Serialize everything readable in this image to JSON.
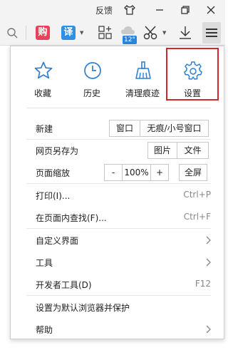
{
  "titlebar": {
    "feedback_label": "反馈",
    "skin_icon": "tshirt-icon",
    "minimize_icon": "minimize-icon",
    "restore_icon": "restore-icon",
    "close_icon": "close-icon"
  },
  "toolbar": {
    "search_icon": "search-icon",
    "shop_badge": "购",
    "translate_badge": "译",
    "apps_icon": "apps-grid-icon",
    "weather_temp": "12°",
    "screenshot_icon": "scissors-icon",
    "download_icon": "download-icon",
    "menu_icon": "hamburger-menu-icon",
    "colors": {
      "shop": "#e8425b",
      "translate": "#2e8fe6",
      "weather": "#2a84d8"
    }
  },
  "menu": {
    "quick_items": [
      {
        "label": "收藏",
        "icon": "star-icon"
      },
      {
        "label": "历史",
        "icon": "clock-icon"
      },
      {
        "label": "清理痕迹",
        "icon": "broom-icon"
      },
      {
        "label": "设置",
        "icon": "gear-icon",
        "highlighted": true
      }
    ],
    "accent_color": "#2f7fd1",
    "highlight_color": "#cf2a2a",
    "new": {
      "label": "新建",
      "window": "窗口",
      "private": "无痕/小号窗口"
    },
    "save_as": {
      "label": "网页另存为",
      "image": "图片",
      "file": "文件"
    },
    "zoom": {
      "label": "页面缩放",
      "minus": "-",
      "value": "100%",
      "plus": "+",
      "fullscreen": "全屏"
    },
    "print": {
      "label": "打印(I)...",
      "shortcut": "Ctrl+P"
    },
    "find": {
      "label": "在页面内查找(F)...",
      "shortcut": "Ctrl+F"
    },
    "customize": {
      "label": "自定义界面"
    },
    "tools": {
      "label": "工具"
    },
    "devtools": {
      "label": "开发者工具(D)",
      "shortcut": "F12"
    },
    "default_browser": {
      "label": "设置为默认浏览器并保护"
    },
    "help": {
      "label": "帮助"
    }
  }
}
